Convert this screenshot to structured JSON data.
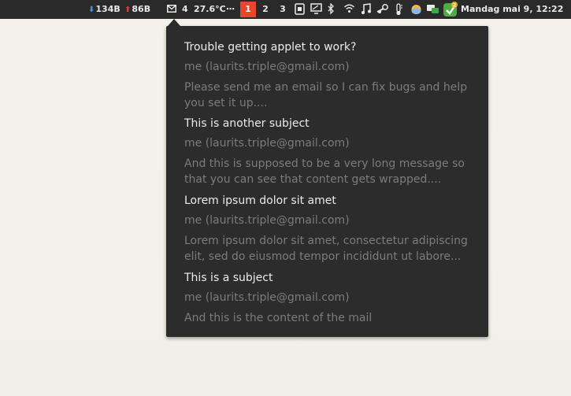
{
  "panel": {
    "net_down": "134B",
    "net_up": "86B",
    "mail_count": "4",
    "temperature": "27.6°C",
    "overflow": "⋯",
    "workspaces": [
      "1",
      "2",
      "3"
    ],
    "active_workspace": "1",
    "update_badge": "2",
    "clock": "Mandag mai  9, 12:22",
    "icons": [
      "download-arrow-icon",
      "upload-arrow-icon",
      "mail-icon",
      "screenshot-icon",
      "display-icon",
      "bluetooth-icon",
      "wifi-icon",
      "music-icon",
      "steam-icon",
      "thermometer-icon",
      "weather-icon",
      "chat-icon",
      "update-icon"
    ],
    "accent_color": "#e8452c"
  },
  "mail_popup": {
    "items": [
      {
        "subject": "Trouble getting applet to work?",
        "sender": "me (laurits.triple@gmail.com)",
        "body": "Please send me an email so I can fix bugs and help you set it up...."
      },
      {
        "subject": "This is another subject",
        "sender": "me (laurits.triple@gmail.com)",
        "body": "And this is supposed to be a very long message so that you can see that content gets wrapped...."
      },
      {
        "subject": "Lorem ipsum dolor sit amet",
        "sender": "me (laurits.triple@gmail.com)",
        "body": "Lorem ipsum dolor sit amet, consectetur adipiscing elit, sed do eiusmod tempor incididunt ut labore..."
      },
      {
        "subject": "This is a subject",
        "sender": "me (laurits.triple@gmail.com)",
        "body": "And this is the content of the mail"
      }
    ]
  }
}
